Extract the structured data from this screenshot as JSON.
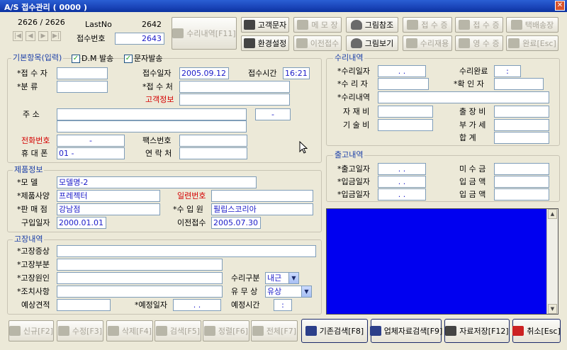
{
  "window": {
    "title": "A/S 접수관리 ( 0000 )",
    "close_glyph": "✕"
  },
  "header": {
    "record_counter": "2626 / 2626",
    "lastno_label": "LastNo",
    "lastno_value": "2642",
    "receipt_no_label": "접수번호",
    "receipt_no_value": "2643"
  },
  "nav": [
    "|◀",
    "◀",
    "▶",
    "▶|"
  ],
  "repair_history_button": "수리내역[F11]",
  "top_buttons": [
    {
      "label": "고객문자",
      "icon": "printer-icon",
      "enabled": true
    },
    {
      "label": "메 모 장",
      "icon": "notepad-icon",
      "enabled": false
    },
    {
      "label": "그림참조",
      "icon": "person-icon",
      "enabled": true
    },
    {
      "label": "접 수 증",
      "icon": "printer-icon",
      "enabled": false
    },
    {
      "label": "접 수 증",
      "icon": "printer-icon",
      "enabled": false
    },
    {
      "label": "택배송장",
      "icon": "truck-icon",
      "enabled": false
    },
    {
      "label": "환경설정",
      "icon": "settings-icon",
      "enabled": true
    },
    {
      "label": "이전접수",
      "icon": "notepad-icon",
      "enabled": false
    },
    {
      "label": "그림보기",
      "icon": "person-icon",
      "enabled": true
    },
    {
      "label": "수리재용",
      "icon": "printer-icon",
      "enabled": false
    },
    {
      "label": "영 수 증",
      "icon": "printer-icon",
      "enabled": false
    },
    {
      "label": "완료[Esc]",
      "icon": "exit-icon",
      "enabled": false
    }
  ],
  "basic": {
    "group_title": "기본항목(입력)",
    "dm_label": "D.M 발송",
    "sms_label": "문자발송",
    "receiver_label": "*접 수 자",
    "category_label": "*분    류",
    "date_label": "접수일자",
    "date_value": "2005.09.12",
    "time_label": "접수시간",
    "time_value": "16:21",
    "place_label": "*접 수 처",
    "customer_info_label": "고객정보",
    "address_label": "주    소",
    "zip_value": "-",
    "phone_label": "전화번호",
    "phone_value": "-",
    "fax_label": "팩스번호",
    "mobile_label": "휴 대 폰",
    "mobile_value": "01 -",
    "contact_label": "연 락 처"
  },
  "product": {
    "group_title": "제품정보",
    "model_label": "*모    델",
    "model_value": "모델명-2",
    "spec_label": "*제품사양",
    "spec_value": "프레젝터",
    "serial_label": "일련번호",
    "shop_label": "*판 매 점",
    "shop_value": "강남점",
    "importer_label": "*수 입 원",
    "importer_value": "필립스코리아",
    "purchase_label": "구입일자",
    "purchase_value": "2000.01.01",
    "prev_label": "이전접수",
    "prev_value": "2005.07.30"
  },
  "fault": {
    "group_title": "고장내역",
    "symptom_label": "*고장증상",
    "part_label": "*고장부분",
    "cause_label": "*고장원인",
    "action_label": "*조치사항",
    "type_label": "수리구분",
    "type_value": "내근",
    "paid_label": "유 무 상",
    "paid_value": "유상",
    "estimate_label": "예상견적",
    "due_label": "*예정일자",
    "due_value": ". .",
    "due_time_label": "예정시간",
    "due_time_value": ":"
  },
  "repair": {
    "group_title": "수리내역",
    "repair_date_label": "*수리일자",
    "repair_date_value": ". .",
    "done_label": "수리완료",
    "done_value": ":",
    "repairer_label": "*수 리 자",
    "checker_label": "*확 인 자",
    "detail_label": "*수리내역",
    "material_label": "자 재 비",
    "travel_label": "출 장 비",
    "tech_label": "기 술 비",
    "vat_label": "부 가 세",
    "total_label": "합    계"
  },
  "release": {
    "group_title": "출고내역",
    "release_date_label": "*출고일자",
    "release_date_value": ". .",
    "unpaid_label": "미 수 금",
    "pay_date1_label": "*입금일자",
    "pay_date1_value": ". .",
    "pay_amt1_label": "입 금 액",
    "pay_date2_label": "*입금일자",
    "pay_date2_value": ". .",
    "pay_amt2_label": "입 금 액"
  },
  "bottom_buttons": [
    {
      "label": "신규[F2]",
      "icon": "new-icon",
      "enabled": false
    },
    {
      "label": "수정[F3]",
      "icon": "edit-icon",
      "enabled": false
    },
    {
      "label": "삭제[F4]",
      "icon": "delete-icon",
      "enabled": false
    },
    {
      "label": "검색[F5]",
      "icon": "search-icon",
      "enabled": false
    },
    {
      "label": "정렬[F6]",
      "icon": "sort-icon",
      "enabled": false
    },
    {
      "label": "전체[F7]",
      "icon": "list-icon",
      "enabled": false
    },
    {
      "label": "기존검색[F8]",
      "icon": "search-icon",
      "enabled": true
    },
    {
      "label": "업체자료검색[F9]",
      "icon": "search-icon",
      "enabled": true
    },
    {
      "label": "자료저장[F12]",
      "icon": "save-icon",
      "enabled": true
    },
    {
      "label": "취소[Esc]",
      "icon": "cancel-icon",
      "enabled": true
    }
  ],
  "colors": {
    "title_bar": "#1a44b8",
    "field_text": "#1a1ac8",
    "required_red": "#d40000",
    "group_title": "#1a3ea8",
    "memo_panel": "#0000f0"
  }
}
